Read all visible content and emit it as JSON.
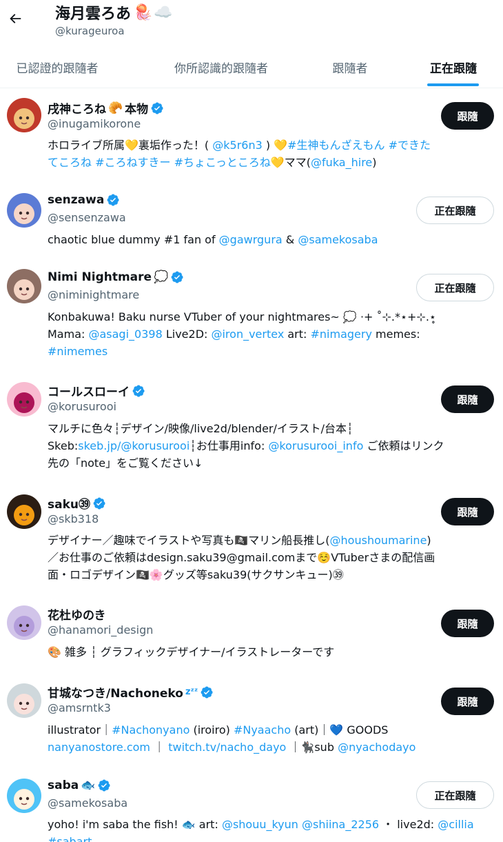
{
  "profile": {
    "name": "海月雲ろあ",
    "name_emojis": [
      "🪼",
      "☁️"
    ],
    "handle": "@kurageuroa"
  },
  "tabs": [
    {
      "label": "已認證的跟隨者",
      "active": false
    },
    {
      "label": "你所認識的跟隨者",
      "active": false
    },
    {
      "label": "跟隨者",
      "active": false
    },
    {
      "label": "正在跟隨",
      "active": true
    }
  ],
  "users": [
    {
      "name": "戌神ころね",
      "name_suffix": "本物",
      "name_emoji": "🥐",
      "verified": true,
      "handle": "@inugamikorone",
      "button": "跟隨",
      "bio": [
        [
          {
            "t": "ホロライブ所属💛裏垢作った！( "
          },
          {
            "t": "@k5r6n3",
            "link": true
          },
          {
            "t": " ) 💛"
          },
          {
            "t": "#生神もんざえもん #できた",
            "link": true
          }
        ],
        [
          {
            "t": "てころね #ころねすきー #ちょこっところね",
            "link": true
          },
          {
            "t": "💛ママ("
          },
          {
            "t": "@fuka_hire",
            "link": true
          },
          {
            "t": ")"
          }
        ]
      ]
    },
    {
      "name": "senzawa",
      "verified": true,
      "handle": "@sensenzawa",
      "button": "正在跟隨",
      "bio": [
        [
          {
            "t": "chaotic blue dummy #1 fan of "
          },
          {
            "t": "@gawrgura",
            "link": true
          },
          {
            "t": " & "
          },
          {
            "t": "@samekosaba",
            "link": true
          }
        ]
      ]
    },
    {
      "name": "Nimi Nightmare",
      "name_emoji": "💭",
      "verified": true,
      "handle": "@niminightmare",
      "button": "正在跟隨",
      "bio": [
        [
          {
            "t": "Konbakuwa! Baku nurse VTuber of your nightmares~ 💭 ⋅+ ˚⊹.*⋆+⊹.⋆̥"
          }
        ],
        [
          {
            "t": "Mama: "
          },
          {
            "t": "@asagi_0398",
            "link": true
          },
          {
            "t": " Live2D: "
          },
          {
            "t": "@iron_vertex",
            "link": true
          },
          {
            "t": " art: "
          },
          {
            "t": "#nimagery",
            "link": true
          },
          {
            "t": " memes:"
          }
        ],
        [
          {
            "t": "#nimemes",
            "link": true
          }
        ]
      ]
    },
    {
      "name": "コールスローイ",
      "verified": true,
      "handle": "@korusurooi",
      "button": "跟隨",
      "bio": [
        [
          {
            "t": "マルチに色々┆デザイン/映像/live2d/blender/イラスト/台本┆"
          }
        ],
        [
          {
            "t": "Skeb:"
          },
          {
            "t": "skeb.jp/@korusurooi",
            "link": true
          },
          {
            "t": "┆お仕事用info: "
          },
          {
            "t": "@korusurooi_info",
            "link": true
          },
          {
            "t": " ご依頼はリンク"
          }
        ],
        [
          {
            "t": "先の「note」をご覧ください↓"
          }
        ]
      ]
    },
    {
      "name": "saku㊴",
      "verified": true,
      "handle": "@skb318",
      "button": "跟隨",
      "bio": [
        [
          {
            "t": "デザイナー／趣味でイラストや写真も🏴‍☠️マリン船長推し("
          },
          {
            "t": "@houshoumarine",
            "link": true
          },
          {
            "t": ")"
          }
        ],
        [
          {
            "t": "／お仕事のご依頼はdesign.saku39@gmail.comまで☺️VTuberさまの配信画"
          }
        ],
        [
          {
            "t": "面・ロゴデザイン🏴‍☠️🌸グッズ等saku39(サクサンキュー)㊴"
          }
        ]
      ]
    },
    {
      "name": "花杜ゆのき",
      "verified": false,
      "handle": "@hanamori_design",
      "button": "跟隨",
      "bio": [
        [
          {
            "t": "🎨 雑多 ┆ グラフィックデザイナー/イラストレーターです"
          }
        ]
      ]
    },
    {
      "name": "甘城なつき/Nachoneko",
      "name_emoji": "zᶻᶻ",
      "verified": true,
      "handle": "@amsrntk3",
      "button": "跟隨",
      "bio": [
        [
          {
            "t": "illustrator｜"
          },
          {
            "t": "#Nachonyano",
            "link": true
          },
          {
            "t": " (iroiro) "
          },
          {
            "t": "#Nyaacho",
            "link": true
          },
          {
            "t": " (art)｜💙 GOODS"
          }
        ],
        [
          {
            "t": "nanyanostore.com",
            "link": true
          },
          {
            "t": " ｜ "
          },
          {
            "t": "twitch.tv/nacho_dayo",
            "link": true
          },
          {
            "t": " ｜🐈‍⬛sub "
          },
          {
            "t": "@nyachodayo",
            "link": true
          }
        ]
      ]
    },
    {
      "name": "saba",
      "name_emoji": "🐟",
      "verified": true,
      "handle": "@samekosaba",
      "button": "正在跟隨",
      "bio": [
        [
          {
            "t": "yoho! i'm saba the fish! 🐟 art: "
          },
          {
            "t": "@shouu_kyun",
            "link": true
          },
          {
            "t": " "
          },
          {
            "t": "@shiina_2256",
            "link": true
          },
          {
            "t": " ・ live2d: "
          },
          {
            "t": "@cillia",
            "link": true
          }
        ],
        [
          {
            "t": "#sabart",
            "link": true
          }
        ]
      ]
    }
  ],
  "colors": {
    "accent": "#1d9bf0",
    "text": "#0f1419",
    "muted": "#536471"
  }
}
